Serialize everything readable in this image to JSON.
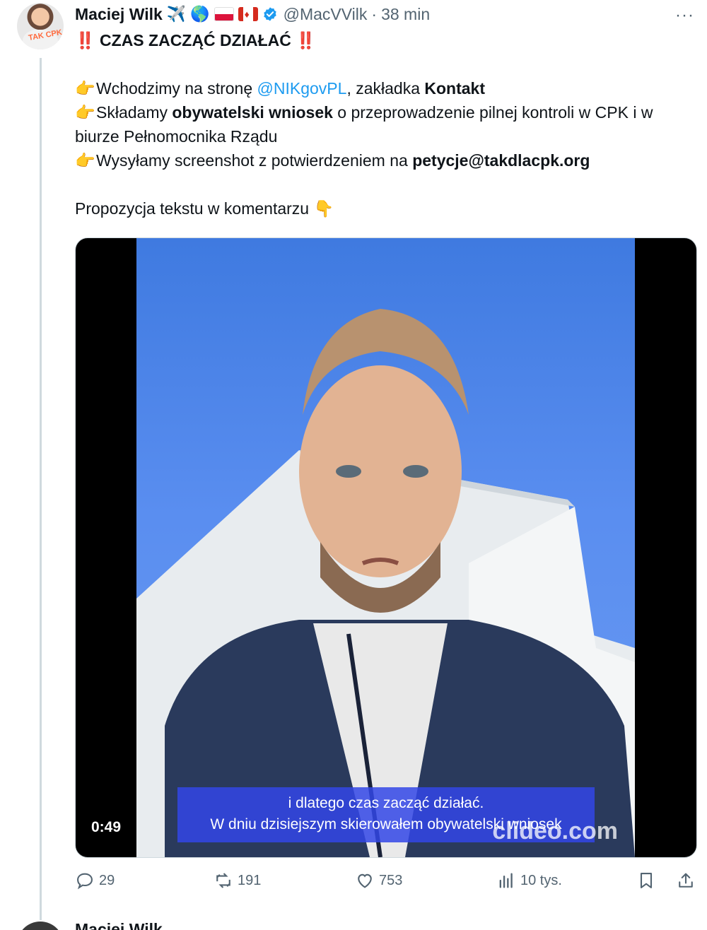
{
  "tweet": {
    "author_name": "Maciej Wilk",
    "author_emojis": [
      "✈️",
      "🌎"
    ],
    "flags": [
      "pl-flag",
      "ca-flag"
    ],
    "handle": "@MacVVilk",
    "separator": "·",
    "time": "38 min",
    "more": "···",
    "avatar_text": "TAK CPK",
    "headline_bang": "‼️",
    "headline": "CZAS ZACZĄĆ DZIAŁAĆ",
    "pointer_emoji": "👉",
    "line1_pre": "Wchodzimy na stronę ",
    "line1_mention": "@NIKgovPL",
    "line1_mid": ", zakładka ",
    "line1_bold": "Kontakt",
    "line2_pre": "Składamy ",
    "line2_bold": "obywatelski wniosek",
    "line2_post": " o przeprowadzenie pilnej kontroli w CPK i w biurze Pełnomocnika Rządu",
    "line3_pre": "Wysyłamy screenshot z potwierdzeniem na ",
    "line3_bold": "petycje@takdlacpk.org",
    "line4": "Propozycja tekstu w komentarzu",
    "line4_emoji": "👇"
  },
  "video": {
    "duration": "0:49",
    "subtitle_line1": "i dlatego czas zacząć działać.",
    "subtitle_line2": "W dniu dzisiejszym skierowałem obywatelski wniosek",
    "watermark": "clideo.com"
  },
  "actions": {
    "replies": "29",
    "reposts": "191",
    "likes": "753",
    "views": "10 tys."
  },
  "next_tweet": {
    "author_name": "Maciej Wilk"
  },
  "colors": {
    "accent": "#1d9bf0",
    "muted": "#536471",
    "subtitle_bg": "#3246e6"
  }
}
